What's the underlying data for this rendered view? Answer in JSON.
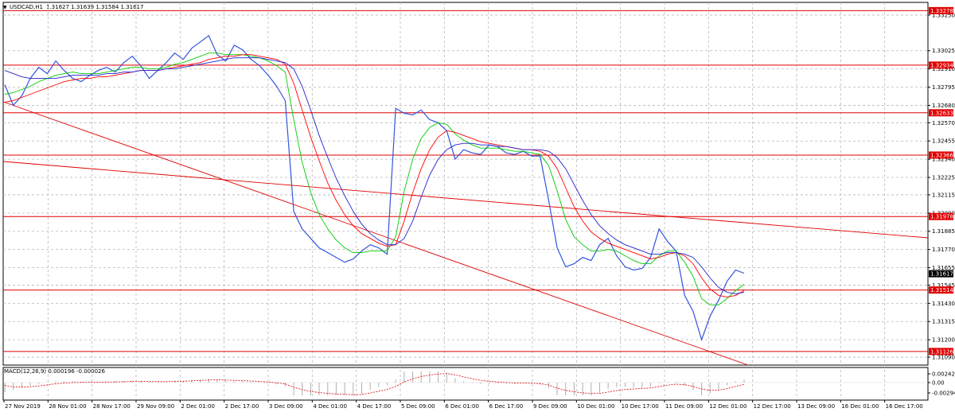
{
  "header": {
    "symbol_label": "USDCAD,H1",
    "ohlc": "1.31627 1.31639 1.31584 1.31617",
    "dropdown_glyph": "▼"
  },
  "price_axis": {
    "ticks": [
      "1.33250",
      "1.33025",
      "1.32910",
      "1.32795",
      "1.32680",
      "1.32570",
      "1.32455",
      "1.32340",
      "1.32225",
      "1.32115",
      "1.32000",
      "1.31885",
      "1.31770",
      "1.31655",
      "1.31545",
      "1.31430",
      "1.31315",
      "1.31200",
      "1.31090"
    ]
  },
  "levels": [
    {
      "price": 1.33278,
      "label": "1.33278"
    },
    {
      "price": 1.32934,
      "label": "1.32934"
    },
    {
      "price": 1.32633,
      "label": "1.32633"
    },
    {
      "price": 1.32366,
      "label": "1.32366"
    },
    {
      "price": 1.31978,
      "label": "1.31978"
    },
    {
      "price": 1.31514,
      "label": "1.31514"
    },
    {
      "price": 1.31126,
      "label": "1.31126"
    }
  ],
  "current_price": {
    "price": 1.31617,
    "label": "1.31617"
  },
  "macd": {
    "label": "MACD(12,26,9) 0.000196 -0.000026",
    "ticks": [
      "0.00242",
      "0.00",
      "-0.00294"
    ]
  },
  "time_axis": {
    "labels": [
      "27 Nov 2019",
      "28 Nov 01:00",
      "28 Nov 17:00",
      "29 Nov 09:00",
      "2 Dec 01:00",
      "2 Dec 17:00",
      "3 Dec 09:00",
      "4 Dec 01:00",
      "4 Dec 17:00",
      "5 Dec 09:00",
      "6 Dec 01:00",
      "6 Dec 17:00",
      "9 Dec 09:00",
      "10 Dec 01:00",
      "10 Dec 17:00",
      "11 Dec 09:00",
      "12 Dec 01:00",
      "12 Dec 17:00",
      "13 Dec 09:00",
      "16 Dec 01:00",
      "16 Dec 17:00"
    ]
  },
  "colors": {
    "price_line": "#3355dd",
    "ma_fast": "#00cc00",
    "ma_mid": "#ff0000",
    "ma_slow": "#2222cc",
    "level_line": "#e00000",
    "trendline": "#e00000",
    "grid": "#b8b8b8",
    "current_price_bg": "#000000",
    "level_label_bg": "#e00000",
    "macd_hist": "#b0b0b0",
    "macd_signal": "#e00000"
  },
  "chart_data": {
    "type": "line",
    "title": "USDCAD,H1",
    "ylim": [
      1.3104,
      1.3333
    ],
    "series": [
      {
        "values": [
          1.3281,
          1.3268,
          1.3274,
          1.3285,
          1.3292,
          1.3288,
          1.3296,
          1.329,
          1.3285,
          1.3283,
          1.3287,
          1.329,
          1.3292,
          1.3289,
          1.3295,
          1.3299,
          1.3293,
          1.3285,
          1.329,
          1.3295,
          1.3301,
          1.3297,
          1.3304,
          1.3308,
          1.3312,
          1.33,
          1.3296,
          1.3306,
          1.3303,
          1.3297,
          1.3293,
          1.3287,
          1.328,
          1.3271,
          1.3201,
          1.319,
          1.3184,
          1.3178,
          1.3175,
          1.3172,
          1.3169,
          1.3171,
          1.3176,
          1.318,
          1.3178,
          1.3174,
          1.3266,
          1.3263,
          1.3262,
          1.3265,
          1.3259,
          1.3257,
          1.3252,
          1.3234,
          1.324,
          1.3238,
          1.3237,
          1.3243,
          1.3242,
          1.3238,
          1.3237,
          1.3239,
          1.3236,
          1.3236,
          1.3208,
          1.3178,
          1.3166,
          1.3168,
          1.3172,
          1.317,
          1.318,
          1.3184,
          1.3173,
          1.3166,
          1.3164,
          1.3165,
          1.3172,
          1.319,
          1.3182,
          1.3176,
          1.3148,
          1.3138,
          1.312,
          1.3135,
          1.3145,
          1.3157,
          1.3164,
          1.3162
        ]
      },
      {
        "values": [
          1.3275,
          1.3276,
          1.3278,
          1.328,
          1.3283,
          1.3285,
          1.3287,
          1.3288,
          1.3289,
          1.3288,
          1.3288,
          1.3288,
          1.3289,
          1.329,
          1.3291,
          1.3292,
          1.3292,
          1.3291,
          1.3291,
          1.3292,
          1.3294,
          1.3295,
          1.3297,
          1.3299,
          1.3301,
          1.3301,
          1.33,
          1.33,
          1.33,
          1.3299,
          1.3298,
          1.3296,
          1.3293,
          1.3289,
          1.3259,
          1.3232,
          1.3213,
          1.3199,
          1.319,
          1.3183,
          1.3178,
          1.3175,
          1.3175,
          1.3176,
          1.3176,
          1.3176,
          1.3185,
          1.3214,
          1.3234,
          1.3247,
          1.3254,
          1.3257,
          1.3256,
          1.325,
          1.3246,
          1.3243,
          1.3241,
          1.3241,
          1.3241,
          1.324,
          1.3239,
          1.3239,
          1.3238,
          1.3237,
          1.323,
          1.3214,
          1.3196,
          1.3185,
          1.318,
          1.3176,
          1.3176,
          1.3177,
          1.3176,
          1.3173,
          1.317,
          1.3168,
          1.3168,
          1.3173,
          1.3176,
          1.3176,
          1.3169,
          1.316,
          1.3146,
          1.3142,
          1.3142,
          1.3146,
          1.3151,
          1.3155
        ]
      },
      {
        "values": [
          1.327,
          1.3271,
          1.3273,
          1.3275,
          1.3277,
          1.3279,
          1.3281,
          1.3283,
          1.3284,
          1.3285,
          1.3285,
          1.3286,
          1.3286,
          1.3287,
          1.3288,
          1.3289,
          1.329,
          1.329,
          1.329,
          1.3291,
          1.3292,
          1.3293,
          1.3294,
          1.3295,
          1.3297,
          1.3298,
          1.3299,
          1.3299,
          1.33,
          1.33,
          1.3299,
          1.3298,
          1.3297,
          1.3294,
          1.3282,
          1.3265,
          1.3248,
          1.3233,
          1.3219,
          1.3208,
          1.3199,
          1.3192,
          1.3187,
          1.3184,
          1.3181,
          1.3179,
          1.318,
          1.3195,
          1.3213,
          1.3228,
          1.324,
          1.3248,
          1.3252,
          1.3251,
          1.3249,
          1.3247,
          1.3245,
          1.3244,
          1.3243,
          1.3242,
          1.3241,
          1.324,
          1.324,
          1.3239,
          1.3236,
          1.3228,
          1.3216,
          1.3204,
          1.3195,
          1.3188,
          1.3184,
          1.3181,
          1.3179,
          1.3177,
          1.3175,
          1.3173,
          1.3171,
          1.3172,
          1.3174,
          1.3175,
          1.3173,
          1.3168,
          1.3159,
          1.3152,
          1.3148,
          1.3147,
          1.3148,
          1.3151
        ]
      },
      {
        "values": [
          1.329,
          1.3288,
          1.3286,
          1.3285,
          1.3285,
          1.3285,
          1.3285,
          1.3286,
          1.3287,
          1.3287,
          1.3287,
          1.3287,
          1.3288,
          1.3288,
          1.3289,
          1.3289,
          1.329,
          1.329,
          1.329,
          1.3291,
          1.3291,
          1.3292,
          1.3293,
          1.3294,
          1.3295,
          1.3296,
          1.3297,
          1.3298,
          1.3298,
          1.3298,
          1.3298,
          1.3297,
          1.3296,
          1.3295,
          1.3291,
          1.328,
          1.3265,
          1.3249,
          1.3235,
          1.3222,
          1.3211,
          1.3201,
          1.3193,
          1.3187,
          1.3183,
          1.318,
          1.318,
          1.3184,
          1.3195,
          1.321,
          1.3224,
          1.3234,
          1.324,
          1.3243,
          1.3244,
          1.3244,
          1.3243,
          1.3243,
          1.3242,
          1.3242,
          1.3241,
          1.324,
          1.324,
          1.324,
          1.3239,
          1.3235,
          1.3228,
          1.3218,
          1.3208,
          1.3199,
          1.3192,
          1.3187,
          1.3183,
          1.318,
          1.3178,
          1.3176,
          1.3174,
          1.3174,
          1.3175,
          1.3175,
          1.3174,
          1.3172,
          1.3166,
          1.3159,
          1.3153,
          1.315,
          1.3149,
          1.315
        ]
      }
    ]
  }
}
